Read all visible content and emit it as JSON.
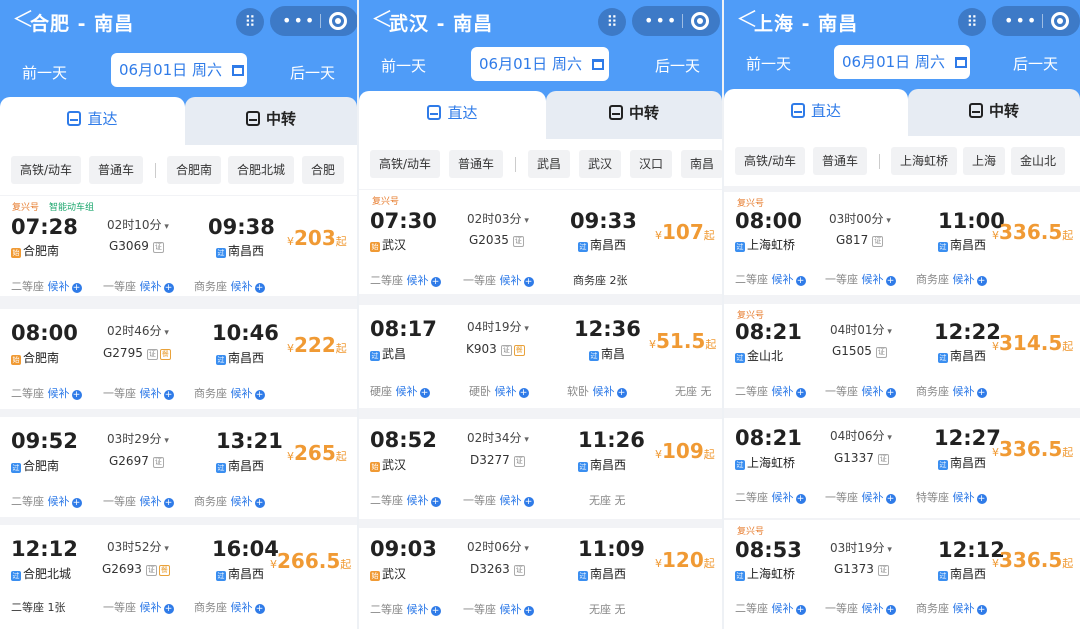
{
  "labels": {
    "back_glyph": "＜",
    "qr_glyph": "⠿",
    "menu_dots": "•••",
    "prev_day": "前一天",
    "next_day": "后一天",
    "tab_direct": "直达",
    "tab_transfer": "中转",
    "yen": "¥",
    "qi": "起",
    "plus": "+"
  },
  "colors": {
    "header": "#4f9cf8",
    "accent": "#2f7be8",
    "price": "#f09a34"
  },
  "panels": [
    {
      "route": "合肥 - 南昌",
      "date": "06月01日  周六",
      "filters": [
        "高铁/动车",
        "普通车",
        "合肥南",
        "合肥北城",
        "合肥"
      ],
      "trains": [
        {
          "tags": [
            "复兴号",
            "智能动车组"
          ],
          "dep_time": "07:28",
          "dep_badge": "始",
          "dep_station": "合肥南",
          "duration": "02时10分",
          "train_no": "G3069",
          "arr_time": "09:38",
          "arr_badge": "过",
          "arr_station": "南昌西",
          "price": "203",
          "seats": [
            {
              "n": "二等座",
              "s": "候补"
            },
            {
              "n": "一等座",
              "s": "候补"
            },
            {
              "n": "商务座",
              "s": "候补"
            }
          ]
        },
        {
          "tags": [],
          "dep_time": "08:00",
          "dep_badge": "始",
          "dep_station": "合肥南",
          "duration": "02时46分",
          "train_no": "G2795",
          "arr_time": "10:46",
          "arr_badge": "过",
          "arr_station": "南昌西",
          "price": "222",
          "seats": [
            {
              "n": "二等座",
              "s": "候补"
            },
            {
              "n": "一等座",
              "s": "候补"
            },
            {
              "n": "商务座",
              "s": "候补"
            }
          ]
        },
        {
          "tags": [],
          "dep_time": "09:52",
          "dep_badge": "过",
          "dep_station": "合肥南",
          "duration": "03时29分",
          "train_no": "G2697",
          "arr_time": "13:21",
          "arr_badge": "过",
          "arr_station": "南昌西",
          "price": "265",
          "seats": [
            {
              "n": "二等座",
              "s": "候补"
            },
            {
              "n": "一等座",
              "s": "候补"
            },
            {
              "n": "商务座",
              "s": "候补"
            }
          ]
        },
        {
          "tags": [],
          "dep_time": "12:12",
          "dep_badge": "过",
          "dep_station": "合肥北城",
          "duration": "03时52分",
          "train_no": "G2693",
          "arr_time": "16:04",
          "arr_badge": "过",
          "arr_station": "南昌西",
          "price": "266.5",
          "seats": [
            {
              "n": "二等座",
              "s": "1张"
            },
            {
              "n": "一等座",
              "s": "候补"
            },
            {
              "n": "商务座",
              "s": "候补"
            }
          ]
        }
      ]
    },
    {
      "route": "武汉 - 南昌",
      "date": "06月01日  周六",
      "filters": [
        "高铁/动车",
        "普通车",
        "武昌",
        "武汉",
        "汉口",
        "南昌"
      ],
      "trains": [
        {
          "tags": [
            "复兴号"
          ],
          "dep_time": "07:30",
          "dep_badge": "始",
          "dep_station": "武汉",
          "duration": "02时03分",
          "train_no": "G2035",
          "arr_time": "09:33",
          "arr_badge": "过",
          "arr_station": "南昌西",
          "price": "107",
          "seats": [
            {
              "n": "二等座",
              "s": "候补"
            },
            {
              "n": "一等座",
              "s": "候补"
            },
            {
              "n": "商务座",
              "s": "2张"
            }
          ]
        },
        {
          "tags": [],
          "dep_time": "08:17",
          "dep_badge": "过",
          "dep_station": "武昌",
          "duration": "04时19分",
          "train_no": "K903",
          "arr_time": "12:36",
          "arr_badge": "过",
          "arr_station": "南昌",
          "price": "51.5",
          "seats": [
            {
              "n": "硬座",
              "s": "候补"
            },
            {
              "n": "硬卧",
              "s": "候补"
            },
            {
              "n": "软卧",
              "s": "候补"
            },
            {
              "n": "无座",
              "s": "无"
            }
          ]
        },
        {
          "tags": [],
          "dep_time": "08:52",
          "dep_badge": "始",
          "dep_station": "武汉",
          "duration": "02时34分",
          "train_no": "D3277",
          "arr_time": "11:26",
          "arr_badge": "过",
          "arr_station": "南昌西",
          "price": "109",
          "seats": [
            {
              "n": "二等座",
              "s": "候补"
            },
            {
              "n": "一等座",
              "s": "候补"
            },
            {
              "n": "无座",
              "s": "无"
            }
          ]
        },
        {
          "tags": [],
          "dep_time": "09:03",
          "dep_badge": "始",
          "dep_station": "武汉",
          "duration": "02时06分",
          "train_no": "D3263",
          "arr_time": "11:09",
          "arr_badge": "过",
          "arr_station": "南昌西",
          "price": "120",
          "seats": [
            {
              "n": "二等座",
              "s": "候补"
            },
            {
              "n": "一等座",
              "s": "候补"
            },
            {
              "n": "无座",
              "s": "无"
            }
          ]
        }
      ]
    },
    {
      "route": "上海 - 南昌",
      "date": "06月01日  周六",
      "filters": [
        "高铁/动车",
        "普通车",
        "上海虹桥",
        "上海",
        "金山北"
      ],
      "trains": [
        {
          "tags": [
            "复兴号"
          ],
          "dep_time": "08:00",
          "dep_badge": "过",
          "dep_station": "上海虹桥",
          "duration": "03时00分",
          "train_no": "G817",
          "arr_time": "11:00",
          "arr_badge": "过",
          "arr_station": "南昌西",
          "price": "336.5",
          "seats": [
            {
              "n": "二等座",
              "s": "候补"
            },
            {
              "n": "一等座",
              "s": "候补"
            },
            {
              "n": "商务座",
              "s": "候补"
            }
          ]
        },
        {
          "tags": [
            "复兴号"
          ],
          "dep_time": "08:21",
          "dep_badge": "过",
          "dep_station": "金山北",
          "duration": "04时01分",
          "train_no": "G1505",
          "arr_time": "12:22",
          "arr_badge": "过",
          "arr_station": "南昌西",
          "price": "314.5",
          "seats": [
            {
              "n": "二等座",
              "s": "候补"
            },
            {
              "n": "一等座",
              "s": "候补"
            },
            {
              "n": "商务座",
              "s": "候补"
            }
          ]
        },
        {
          "tags": [],
          "dep_time": "08:21",
          "dep_badge": "过",
          "dep_station": "上海虹桥",
          "duration": "04时06分",
          "train_no": "G1337",
          "arr_time": "12:27",
          "arr_badge": "过",
          "arr_station": "南昌西",
          "price": "336.5",
          "seats": [
            {
              "n": "二等座",
              "s": "候补"
            },
            {
              "n": "一等座",
              "s": "候补"
            },
            {
              "n": "特等座",
              "s": "候补"
            }
          ]
        },
        {
          "tags": [
            "复兴号"
          ],
          "dep_time": "08:53",
          "dep_badge": "过",
          "dep_station": "上海虹桥",
          "duration": "03时19分",
          "train_no": "G1373",
          "arr_time": "12:12",
          "arr_badge": "过",
          "arr_station": "南昌西",
          "price": "336.5",
          "seats": [
            {
              "n": "二等座",
              "s": "候补"
            },
            {
              "n": "一等座",
              "s": "候补"
            },
            {
              "n": "商务座",
              "s": "候补"
            }
          ]
        }
      ]
    }
  ]
}
